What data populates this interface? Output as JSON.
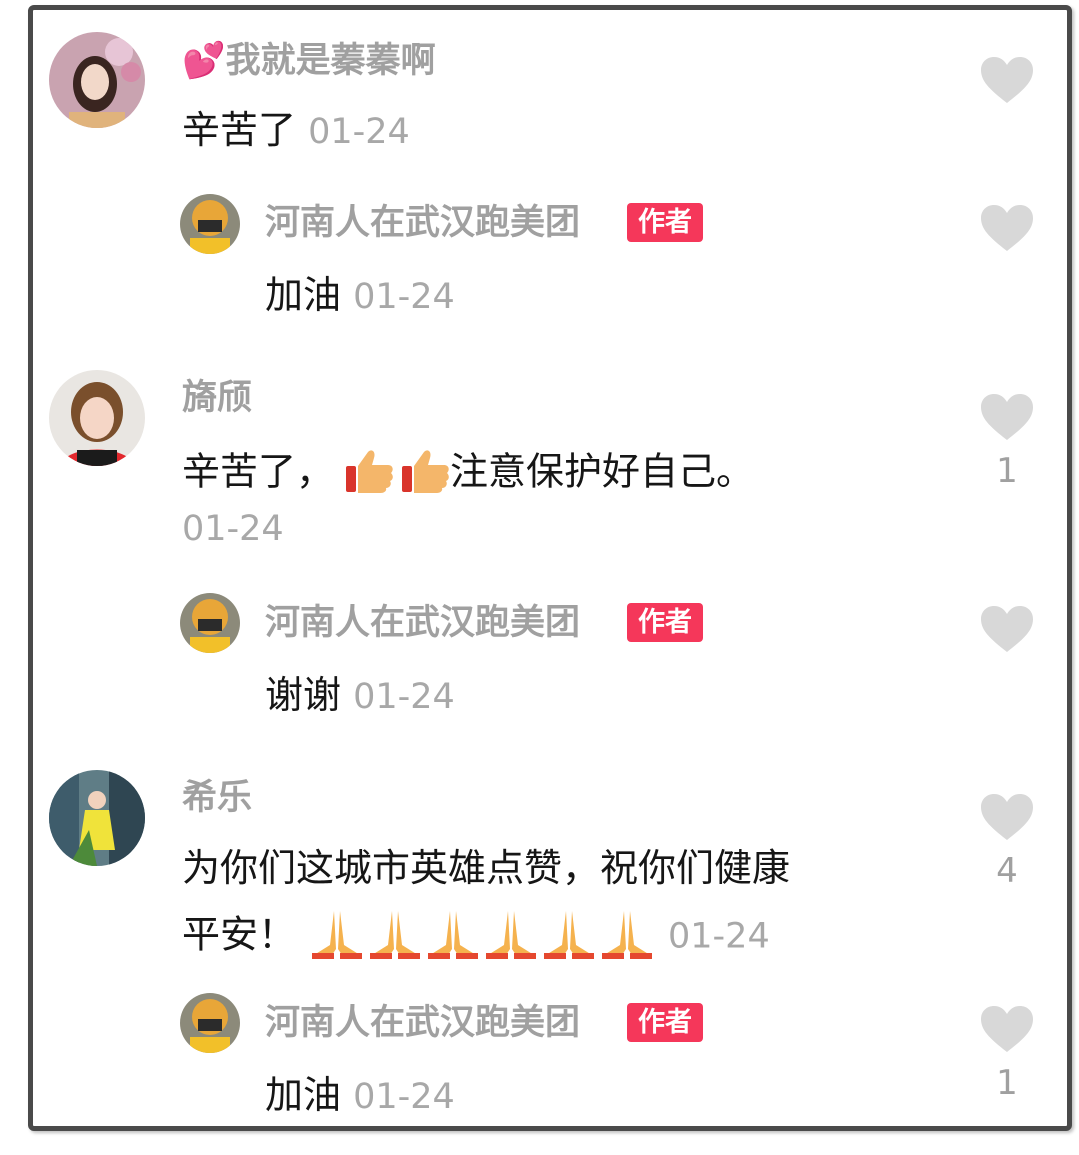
{
  "comments": [
    {
      "user": "💕我就是蓁蓁啊",
      "text": "辛苦了",
      "date": "01-24",
      "likes": "",
      "reply": {
        "user": "河南人在武汉跑美团",
        "badge": "作者",
        "text": "加油",
        "date": "01-24",
        "likes": ""
      }
    },
    {
      "user": "旖颀",
      "text_before": "辛苦了，",
      "text_after": "注意保护好自己。",
      "emoji": "thumbs-up x2",
      "date": "01-24",
      "likes": "1",
      "reply": {
        "user": "河南人在武汉跑美团",
        "badge": "作者",
        "text": "谢谢",
        "date": "01-24",
        "likes": ""
      }
    },
    {
      "user": "希乐",
      "text_line1": "为你们这城市英雄点赞，祝你们健康",
      "text_line2": "平安！",
      "emoji": "folded-hands x6",
      "date": "01-24",
      "likes": "4",
      "reply": {
        "user": "河南人在武汉跑美团",
        "badge": "作者",
        "text": "加油",
        "date": "01-24",
        "likes": "1"
      }
    }
  ],
  "colors": {
    "badge": "#f5375a",
    "username": "#a0a0a0",
    "heart": "#d8d8d8",
    "text": "#161616"
  }
}
